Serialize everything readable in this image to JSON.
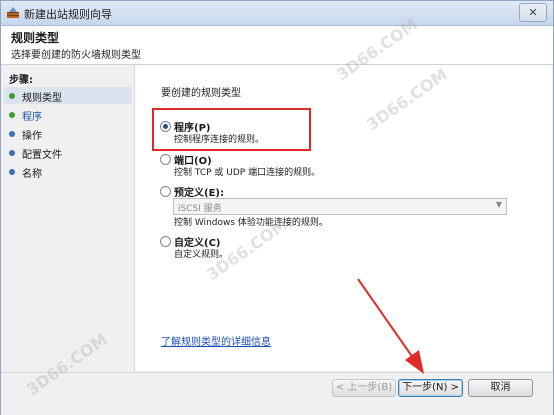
{
  "window": {
    "title": "新建出站规则向导",
    "close": "✕"
  },
  "header": {
    "title": "规则类型",
    "subtitle": "选择要创建的防火墙规则类型"
  },
  "steps": {
    "title": "步骤:",
    "items": [
      {
        "label": "规则类型",
        "color": "#3d9b2f",
        "active": true
      },
      {
        "label": "程序",
        "color": "#3d9b2f",
        "link": true
      },
      {
        "label": "操作",
        "color": "#3d6fb5"
      },
      {
        "label": "配置文件",
        "color": "#3d6fb5"
      },
      {
        "label": "名称",
        "color": "#3d6fb5"
      }
    ]
  },
  "main": {
    "prompt": "要创建的规则类型",
    "options": [
      {
        "label": "程序(P)",
        "desc": "控制程序连接的规则。",
        "checked": true
      },
      {
        "label": "端口(O)",
        "desc": "控制 TCP 或 UDP 端口连接的规则。",
        "checked": false
      },
      {
        "label": "预定义(E):",
        "desc": "控制 Windows 体验功能连接的规则。",
        "checked": false,
        "select_value": "iSCSI 服务"
      },
      {
        "label": "自定义(C)",
        "desc": "自定义规则。",
        "checked": false
      }
    ],
    "help_link": "了解规则类型的详细信息"
  },
  "footer": {
    "back": "< 上一步(B)",
    "next": "下一步(N) >",
    "cancel": "取消"
  },
  "watermark": "3D66.COM",
  "colors": {
    "highlight": "#e02b2b",
    "link": "#1c4fb8"
  }
}
